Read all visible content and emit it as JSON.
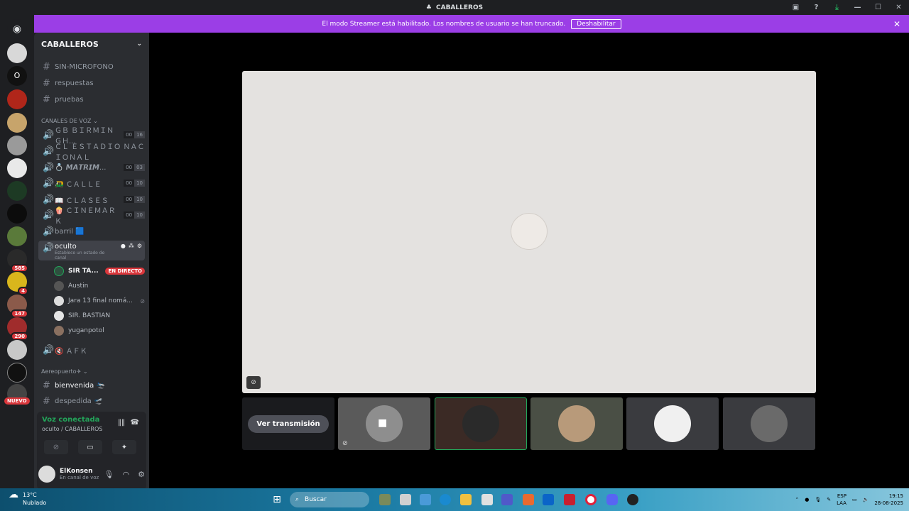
{
  "window": {
    "title": "CABALLEROS",
    "controls": [
      "—",
      "☐",
      "✕"
    ]
  },
  "banner": {
    "text": "El modo Streamer está habilitado. Los nombres de usuario se han truncado.",
    "button": "Deshabilitar"
  },
  "guilds": [
    {
      "badge": ""
    },
    {
      "badge": ""
    },
    {
      "badge": ""
    },
    {
      "badge": ""
    },
    {
      "badge": ""
    },
    {
      "badge": ""
    },
    {
      "badge": ""
    },
    {
      "badge": ""
    },
    {
      "badge": ""
    },
    {
      "badge": "585"
    },
    {
      "badge": "4"
    },
    {
      "badge": "147"
    },
    {
      "badge": "290"
    },
    {
      "badge": ""
    },
    {
      "badge": ""
    }
  ],
  "guild_letter": "O",
  "nuevo_label": "NUEVO",
  "server": {
    "name": "CABALLEROS"
  },
  "text_channels": [
    "SIN-MICROFONO",
    "respuestas",
    "pruebas"
  ],
  "voice_category": "CANALES DE VOZ",
  "voice_channels": [
    {
      "name": "ＧＢ ＢＩＲＭＩＮＧＨ...",
      "c1": "00",
      "c2": "16"
    },
    {
      "name": "ＣＬ ＥＳＴＡＤＩＯ ＮＡＣＩＯＮＡＬ",
      "c1": "",
      "c2": ""
    },
    {
      "name": "💍 𝙈𝘼𝙏𝙍𝙄𝙈...",
      "c1": "00",
      "c2": "03"
    },
    {
      "name": "🛺 ＣＡＬＬＥ",
      "c1": "00",
      "c2": "10"
    },
    {
      "name": "📖 ＣＬＡＳＥＳ",
      "c1": "00",
      "c2": "10"
    },
    {
      "name": "🍿 ＣＩＮＥＭＡＲＫ",
      "c1": "00",
      "c2": "10"
    },
    {
      "name": "barril 🟦",
      "c1": "",
      "c2": ""
    }
  ],
  "active_channel": {
    "name": "oculto",
    "status": "Establece un estado de canal"
  },
  "members": [
    {
      "name": "SIR TA...",
      "live": "EN DIRECTO"
    },
    {
      "name": "Austin",
      "live": ""
    },
    {
      "name": "Jara 13 final nomá...",
      "live": ""
    },
    {
      "name": "SIR. BASTIAN",
      "live": ""
    },
    {
      "name": "yuganpotol",
      "live": ""
    }
  ],
  "afk_channel": "🔇 ＡＦＫ",
  "category2": "Aereopuerto✈",
  "text_channels2": [
    "bienvenida 🛬",
    "despedida 🛫"
  ],
  "voice_panel": {
    "title": "Voz conectada",
    "subtitle": "oculto / CABALLEROS"
  },
  "user": {
    "name": "ElKonsen",
    "status": "En canal de voz"
  },
  "tiles": {
    "watch_label": "Ver transmisión"
  },
  "taskbar": {
    "temp": "13°C",
    "weather": "Nublado",
    "search": "Buscar",
    "lang1": "ESP",
    "lang2": "LAA",
    "time": "19:15",
    "date": "28-08-2025"
  }
}
